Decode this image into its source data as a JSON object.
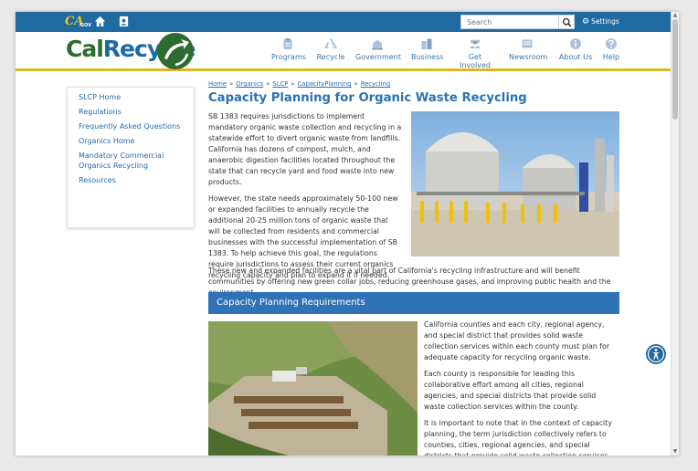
{
  "topbar": {
    "logo_main": "CA",
    "logo_sub": ".GOV",
    "search_placeholder": "Search",
    "settings_label": "Settings"
  },
  "header": {
    "brand_part1": "Cal",
    "brand_part2": "Recycle",
    "nav": [
      {
        "label": "Programs",
        "icon": "clipboard-icon"
      },
      {
        "label": "Recycle",
        "icon": "recycle-icon"
      },
      {
        "label": "Government",
        "icon": "capitol-icon"
      },
      {
        "label": "Business",
        "icon": "buildings-icon"
      },
      {
        "label": "Get Involved",
        "icon": "people-icon"
      },
      {
        "label": "Newsroom",
        "icon": "newspaper-icon"
      },
      {
        "label": "About Us",
        "icon": "info-icon"
      },
      {
        "label": "Help",
        "icon": "question-icon"
      }
    ]
  },
  "sidebar": {
    "items": [
      "SLCP Home",
      "Regulations",
      "Frequently Asked Questions",
      "Organics Home",
      "Mandatory Commercial Organics Recycling",
      "Resources"
    ]
  },
  "breadcrumbs": [
    "Home",
    "Organics",
    "SLCP",
    "CapacityPlanning",
    "Recycling"
  ],
  "breadcrumb_separator": "»",
  "page_title": "Capacity Planning for Organic Waste Recycling",
  "intro": {
    "p1": "SB 1383 requires jurisdictions to implement mandatory organic waste collection and recycling in a statewide effort to divert organic waste from landfills. California has dozens of compost, mulch, and anaerobic digestion facilities located throughout the state that can recycle yard and food waste into new products.",
    "p2": "However, the state needs approximately 50-100 new or expanded facilities to annually recycle the additional 20-25 million tons of organic waste that will be collected from residents and commercial businesses with the successful implementation of SB 1383. To help achieve this goal, the regulations require jurisdictions to assess their current organics recycling capacity and plan to expand it if needed.",
    "p3": "These new and expanded facilities are a vital part of California's recycling infrastructure and will benefit communities by offering new green collar jobs, reducing greenhouse gases, and improving public health and the environment."
  },
  "section": {
    "title": "Capacity Planning Requirements",
    "p1": "California counties and each city, regional agency, and special district that provides solid waste collection services within each county must plan for adequate capacity for recycling organic waste.",
    "p2": "Each county is responsible for leading this collaborative effort among all cities, regional agencies, and special districts that provide solid waste collection services within the county.",
    "p3": "It is important to note that in the context of capacity planning, the term jurisdiction collectively refers to counties, cities, regional agencies, and special districts that provide solid waste collection services."
  },
  "colors": {
    "topbar": "#1f6aa1",
    "accent_gold": "#e3b522",
    "brand_green": "#2b6d31",
    "brand_blue": "#1c6aa6",
    "link": "#276ba9",
    "section_band": "#2f72b5"
  }
}
